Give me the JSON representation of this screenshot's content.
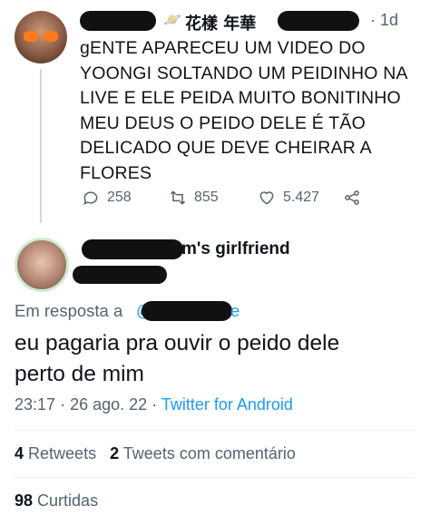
{
  "parent_tweet": {
    "display_name_suffix": "花樣 年華",
    "timestamp": "1d",
    "text": "gENTE APARECEU UM VIDEO DO\nYOONGI SOLTANDO UM PEIDINHO NA\nLIVE E ELE PEIDA MUITO BONITINHO\nMEU DEUS O PEIDO DELE É TÃO\nDELICADO QUE DEVE CHEIRAR A\nFLORES",
    "actions": {
      "replies": "258",
      "retweets": "855",
      "likes": "5.427"
    }
  },
  "focused_tweet": {
    "display_name_suffix": "m's girlfriend",
    "reply_prefix": "Em resposta a",
    "reply_at_start": "@",
    "reply_at_end": "e",
    "text": "eu pagaria pra ouvir o peido dele\nperto de mim",
    "time": "23:17",
    "date": "26 ago. 22",
    "source": "Twitter for Android",
    "separator": "·"
  },
  "stats": {
    "retweets_count": "4",
    "retweets_label": "Retweets",
    "quotes_count": "2",
    "quotes_label": "Tweets com comentário",
    "likes_count": "98",
    "likes_label": "Curtidas"
  },
  "colors": {
    "accent": "#1d9bf0",
    "secondary_text": "#536471",
    "redaction": "#111111"
  }
}
